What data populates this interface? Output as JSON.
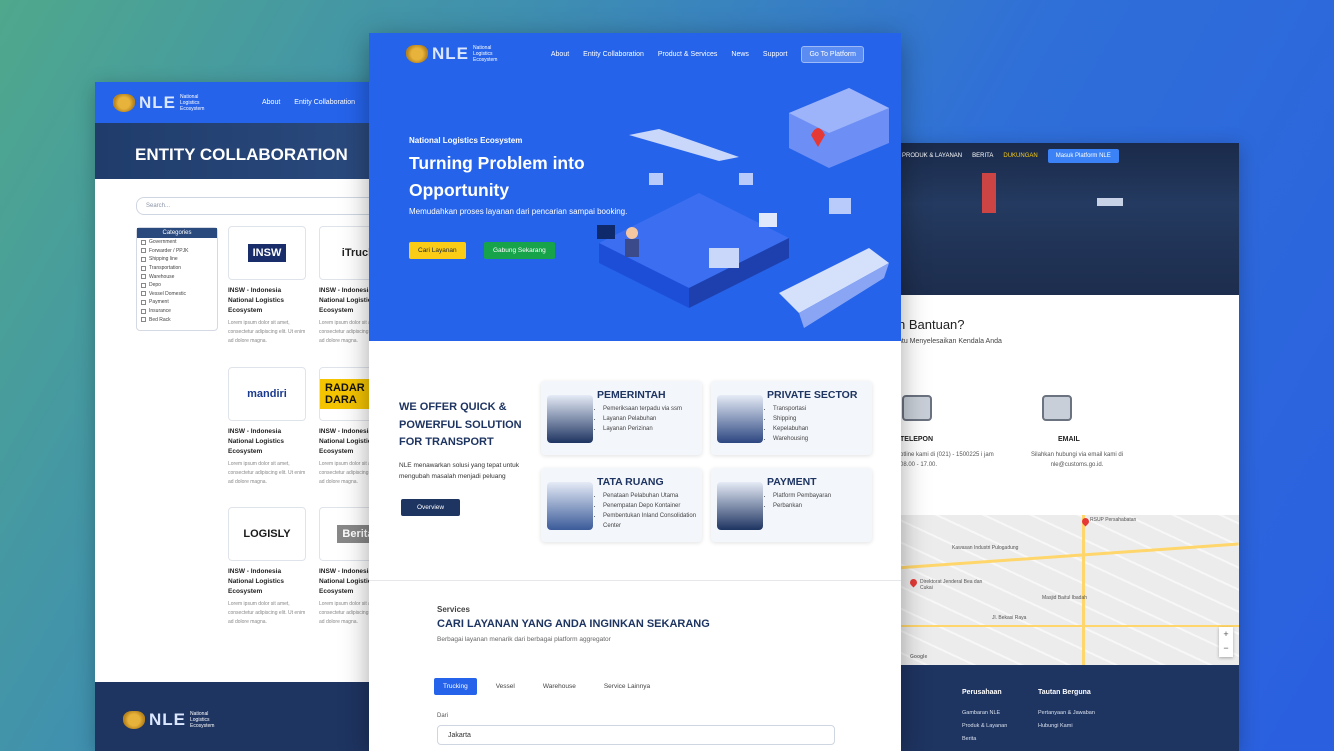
{
  "left": {
    "nav": {
      "brand": "NLE",
      "brand_sub": "National Logistics Ecosystem",
      "links": [
        "About",
        "Entity Collaboration"
      ]
    },
    "hero_title": "ENTITY COLLABORATION",
    "search_placeholder": "Search...",
    "categories": {
      "title": "Categories",
      "items": [
        "Government",
        "Forwarder / PPJK",
        "Shipping line",
        "Transportation",
        "Warehouse",
        "Depo",
        "Vessel Domestic",
        "Payment",
        "Insurance",
        "Bed Rack"
      ]
    },
    "cards": [
      {
        "logo": "INSW",
        "title": "INSW - Indonesia National Logistics Ecosystem",
        "desc": "Lorem ipsum dolor sit amet, consectetur adipiscing elit. Ut enim ad dolore magna."
      },
      {
        "logo": "iTruck",
        "title": "INSW - Indonesia National Logistics Ecosystem",
        "desc": "Lorem ipsum dolor sit amet, consectetur adipiscing elit. Ut enim ad dolore magna."
      },
      {
        "logo": "mandiri",
        "title": "INSW - Indonesia National Logistics Ecosystem",
        "desc": "Lorem ipsum dolor sit amet, consectetur adipiscing elit. Ut enim ad dolore magna."
      },
      {
        "logo": "RADAR DARA",
        "title": "INSW - Indonesia National Logistics Ecosystem",
        "desc": "Lorem ipsum dolor sit amet, consectetur adipiscing elit. Ut enim ad dolore magna."
      },
      {
        "logo": "LOGISLY",
        "title": "INSW - Indonesia National Logistics Ecosystem",
        "desc": "Lorem ipsum dolor sit amet, consectetur adipiscing elit. Ut enim ad dolore magna."
      },
      {
        "logo": "Berita",
        "title": "INSW - Indonesia National Logistics Ecosystem",
        "desc": "Lorem ipsum dolor sit amet, consectetur adipiscing elit. Ut enim ad dolore magna."
      }
    ]
  },
  "center": {
    "nav": {
      "brand": "NLE",
      "brand_sub": "National Logistics Ecosystem",
      "links": [
        "About",
        "Entity Collaboration",
        "Product & Services",
        "News",
        "Support"
      ],
      "cta": "Go To Platform"
    },
    "hero": {
      "kicker": "National Logistics Ecosystem",
      "title": "Turning Problem into Opportunity",
      "desc": "Memudahkan proses layanan dari pencarian sampai booking.",
      "btn_primary": "Cari Layanan",
      "btn_secondary": "Gabung Sekarang"
    },
    "offer": {
      "title": "WE OFFER QUICK & POWERFUL SOLUTION FOR TRANSPORT",
      "desc": "NLE menawarkan solusi yang tepat untuk mengubah masalah menjadi peluang",
      "button": "Overview"
    },
    "services": [
      {
        "title": "PEMERINTAH",
        "items": [
          "Pemeriksaan terpadu via ssm",
          "Layanan Pelabuhan",
          "Layanan Perizinan"
        ]
      },
      {
        "title": "PRIVATE SECTOR",
        "items": [
          "Transportasi",
          "Shipping",
          "Kepelabuhan",
          "Warehousing"
        ]
      },
      {
        "title": "TATA RUANG",
        "items": [
          "Penataan Pelabuhan Utama",
          "Penempatan Depo Kontainer",
          "Pembentukan Inland Consolidation Center"
        ]
      },
      {
        "title": "PAYMENT",
        "items": [
          "Platform Pembayaran",
          "Perbankan"
        ]
      }
    ],
    "services_section": {
      "kicker": "Services",
      "title": "CARI LAYANAN YANG ANDA INGINKAN SEKARANG",
      "subtitle": "Berbagai layanan menarik dari berbagai platform aggregator",
      "tabs": [
        "Trucking",
        "Vessel",
        "Warehouse",
        "Service Lainnya"
      ],
      "active_tab": "Trucking",
      "field_label": "Dari",
      "field_value": "Jakarta"
    }
  },
  "right": {
    "nav": {
      "links": [
        "PRODUK & LAYANAN",
        "BERITA",
        "DUKUNGAN"
      ],
      "cta": "Masuk Platform NLE"
    },
    "help_title": "n Bantuan?",
    "help_sub": "ntu Menyelesaikan Kendala Anda",
    "contacts": [
      {
        "label": "TELEPON",
        "text": "otline kami di (021) - 1500225 i jam 08.00 - 17.00."
      },
      {
        "label": "EMAIL",
        "text": "Silahkan hubungi via email kami di nle@customs.go.id."
      }
    ],
    "map_labels": [
      "RSUP Persahabatan",
      "Direktorat Jenderal Bea dan Cukai",
      "Kawasan Industri Pulogadung",
      "Masjid Baitul Ibadah",
      "Jl. Bekasi Raya",
      "Google"
    ],
    "footer": {
      "col1_title": "Perusahaan",
      "col1_links": [
        "Gambaran NLE",
        "Produk & Layanan",
        "Berita"
      ],
      "col2_title": "Tautan Berguna",
      "col2_links": [
        "Pertanyaan & Jawaban",
        "Hubungi Kami"
      ]
    }
  },
  "colors": {
    "primary": "#2563eb",
    "navy": "#1e3461",
    "yellow": "#facc15",
    "green": "#16a34a"
  }
}
